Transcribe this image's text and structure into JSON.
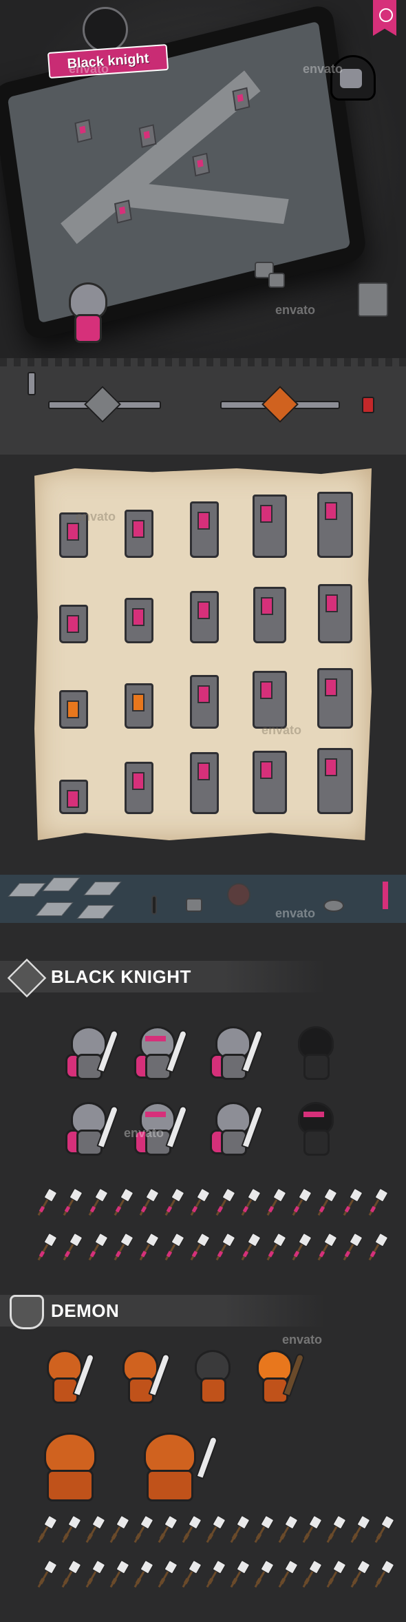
{
  "hero": {
    "logo_text": "Black knight",
    "watermark": "envato"
  },
  "paper": {
    "watermark": "envato"
  },
  "sections": {
    "black_knight": "BLACK KNIGHT",
    "demon": "DEMON"
  },
  "colors": {
    "accent": "#d6307a",
    "background": "#2b2b2c",
    "parchment": "#e6d7bc",
    "demon": "#d0621f"
  }
}
